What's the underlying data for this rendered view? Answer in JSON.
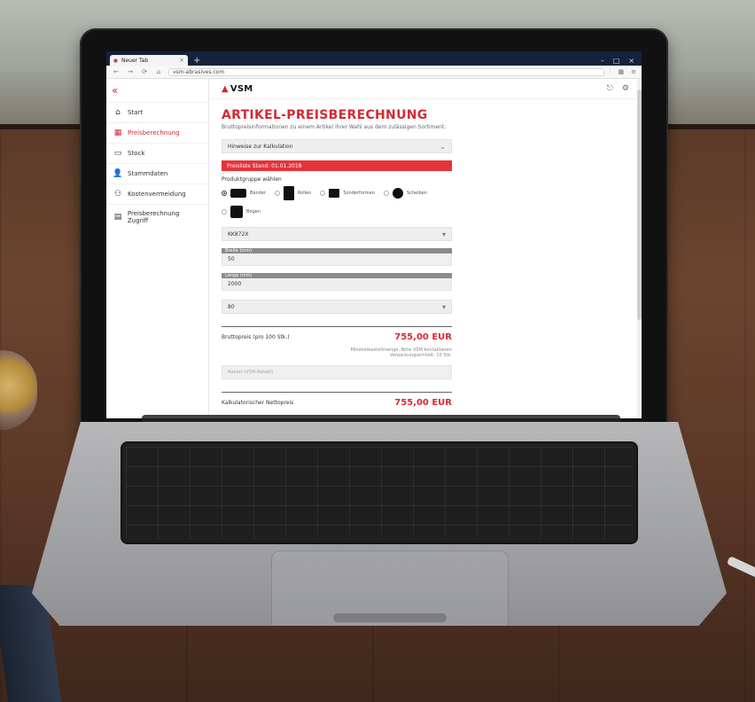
{
  "browser": {
    "tab_title": "Neuer Tab",
    "new_tab_symbol": "+",
    "url": "vsm-abrasives.com",
    "window_controls": [
      "–",
      "□",
      "×"
    ],
    "nav_back": "←",
    "nav_forward": "→",
    "nav_reload": "⟳",
    "nav_home": "⌂",
    "right_icons": [
      "⫶",
      "▦",
      "≡"
    ]
  },
  "sidebar": {
    "collapse_symbol": "«",
    "items": [
      {
        "label": "Start",
        "icon": "home-icon"
      },
      {
        "label": "Preisberechnung",
        "icon": "calculator-icon"
      },
      {
        "label": "Stock",
        "icon": "stock-icon"
      },
      {
        "label": "Stammdaten",
        "icon": "user-icon"
      },
      {
        "label": "Kostenvermeidung",
        "icon": "user-plus-icon"
      },
      {
        "label": "Preisberechnung Zugriff",
        "icon": "document-icon"
      }
    ]
  },
  "header": {
    "logo": "VSM",
    "top_icons": [
      "⎋",
      "⚙"
    ]
  },
  "page": {
    "title": "ARTIKEL-PREISBERECHNUNG",
    "subtitle": "Bruttopreisinformationen zu einem Artikel ihrer Wahl aus dem zulässigen Sortiment.",
    "hint_select": "Hinweise zur Kalkulation",
    "alert": "Preisliste Stand: 01.01.2018",
    "product_group_label": "Produktgruppe wählen",
    "product_groups": [
      {
        "label": "Bänder",
        "selected": true
      },
      {
        "label": "Rollen",
        "selected": false
      },
      {
        "label": "Sonderformen",
        "selected": false
      },
      {
        "label": "Scheiben",
        "selected": false
      },
      {
        "label": "Bogen",
        "selected": false
      }
    ],
    "material_select": "KK872X",
    "field1_caption": "Breite (mm)",
    "field1_value": "50",
    "field2_caption": "Länge (mm)",
    "field2_value": "2000",
    "grit_select": "80",
    "gross_price_label": "Bruttopreis (pro 100 Stk.)",
    "gross_price_value": "755,00 EUR",
    "note_line1": "Mindestbestellmenge: Bitte VSM kontaktieren",
    "note_line2": "Verpackungseinheit: 10 Stk.",
    "discount_placeholder": "Rabatt (VSM-Rabatt)",
    "net_price_label": "Kalkulatorischer Nettopreis",
    "net_price_value": "755,00 EUR"
  },
  "colors": {
    "accent": "#d42a34",
    "tabbar": "#16223d"
  }
}
